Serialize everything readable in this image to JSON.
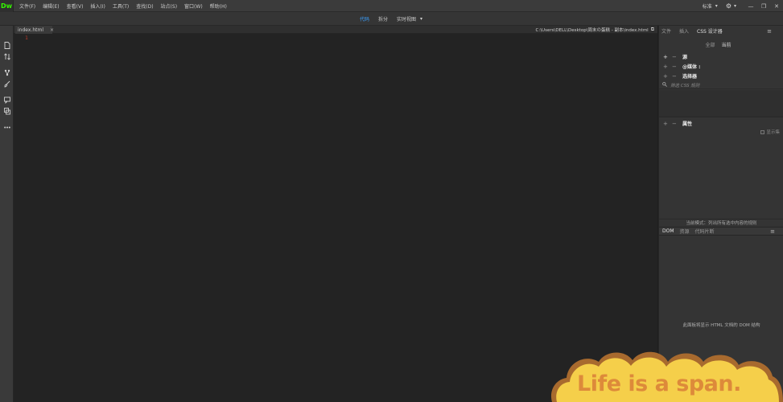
{
  "app": {
    "logo": "Dw"
  },
  "menu": {
    "items": [
      "文件(F)",
      "编辑(E)",
      "查看(V)",
      "插入(I)",
      "工具(T)",
      "查找(D)",
      "站点(S)",
      "窗口(W)",
      "帮助(H)"
    ],
    "workspace": "标准",
    "workspace_caret": "▾",
    "gear": "⚙",
    "gear_caret": "▾",
    "min": "—",
    "restore": "❐",
    "close": "✕"
  },
  "views": {
    "code": "代码",
    "split": "拆分",
    "live": "实时视图",
    "caret": "▾"
  },
  "document": {
    "tab_name": "index.html",
    "tab_close": "×",
    "path": "C:\\Users\\DELL\\Desktop\\周末の蛋糕 - 副本\\index.html",
    "open_icon": "⧉",
    "line_number": "1"
  },
  "right_panel": {
    "tabs": [
      "文件",
      "插入",
      "CSS 设计器"
    ],
    "active_tab": 2,
    "menu_icon": "≡",
    "subtabs": [
      "全部",
      "当前"
    ],
    "active_subtab": 1,
    "sections": {
      "sources": "源",
      "media": "@媒体 :",
      "selectors": "选择器",
      "properties": "属性"
    },
    "filter_placeholder": "筛选 CSS 规则",
    "show_set": "显示集",
    "mode_hint": "当前模式：列出所有选中内容的规则",
    "dom_tabs": [
      "DOM",
      "资源",
      "代码片断"
    ],
    "dom_active": 0,
    "dom_empty": "此面板将显示 HTML 文档的 DOM 结构"
  },
  "watermark": {
    "text": "Life is a span."
  },
  "colors": {
    "accent_blue": "#3aa0ff",
    "logo_green": "#35fa00",
    "line_number_red": "#c03a2a",
    "sticker_fill": "#f5cf4a",
    "sticker_text": "#dd8a3a"
  }
}
